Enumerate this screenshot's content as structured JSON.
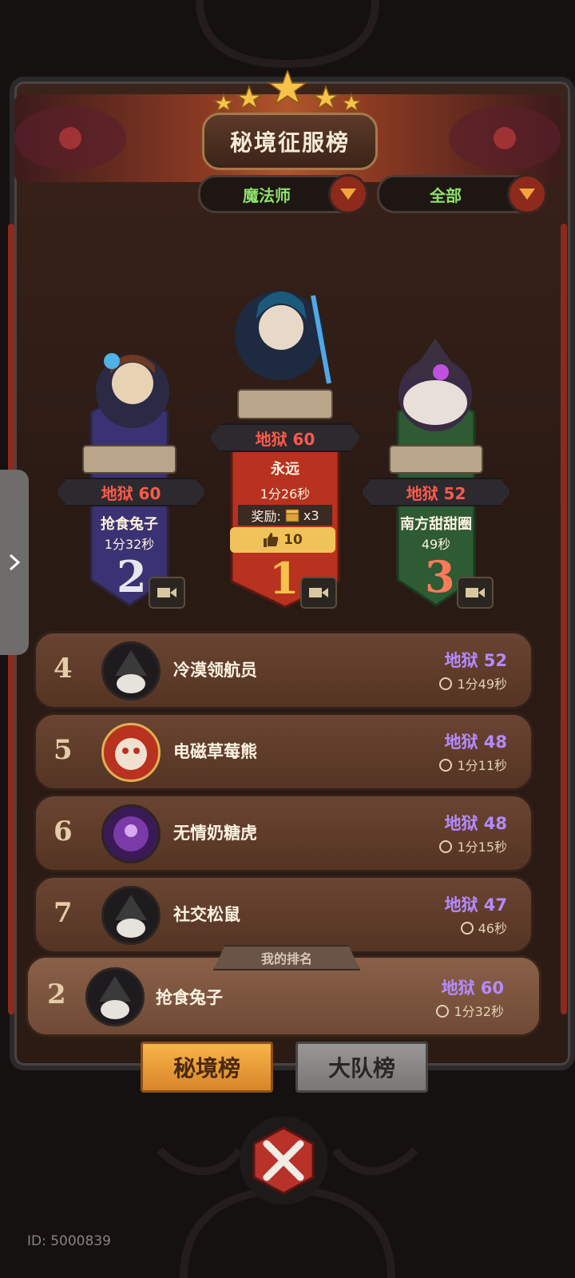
{
  "header": {
    "title": "秘境征服榜"
  },
  "filters": {
    "class": "魔法师",
    "scope": "全部"
  },
  "podium": [
    {
      "rank": "2",
      "difficulty": "地狱 60",
      "name": "抢食兔子",
      "time": "1分32秒"
    },
    {
      "rank": "1",
      "difficulty": "地狱 60",
      "name": "永远",
      "time": "1分26秒",
      "reward_label": "奖励:",
      "reward_count": "x3",
      "likes": "10"
    },
    {
      "rank": "3",
      "difficulty": "地狱 52",
      "name": "南方甜甜圈",
      "time": "49秒"
    }
  ],
  "list": [
    {
      "rank": "4",
      "name": "冷漠领航员",
      "difficulty": "地狱 52",
      "time": "1分49秒"
    },
    {
      "rank": "5",
      "name": "电磁草莓熊",
      "difficulty": "地狱 48",
      "time": "1分11秒"
    },
    {
      "rank": "6",
      "name": "无情奶糖虎",
      "difficulty": "地狱 48",
      "time": "1分15秒"
    },
    {
      "rank": "7",
      "name": "社交松鼠",
      "difficulty": "地狱 47",
      "time": "46秒"
    }
  ],
  "my_rank": {
    "label": "我的排名",
    "rank": "2",
    "name": "抢食兔子",
    "difficulty": "地狱 60",
    "time": "1分32秒"
  },
  "tabs": {
    "secret": "秘境榜",
    "team": "大队榜"
  },
  "footer": {
    "id": "ID: 5000839"
  },
  "colors": {
    "accent": "#f2a63a",
    "diff": "#b48bff",
    "red": "#ff5a4a",
    "green": "#8fe06c"
  }
}
